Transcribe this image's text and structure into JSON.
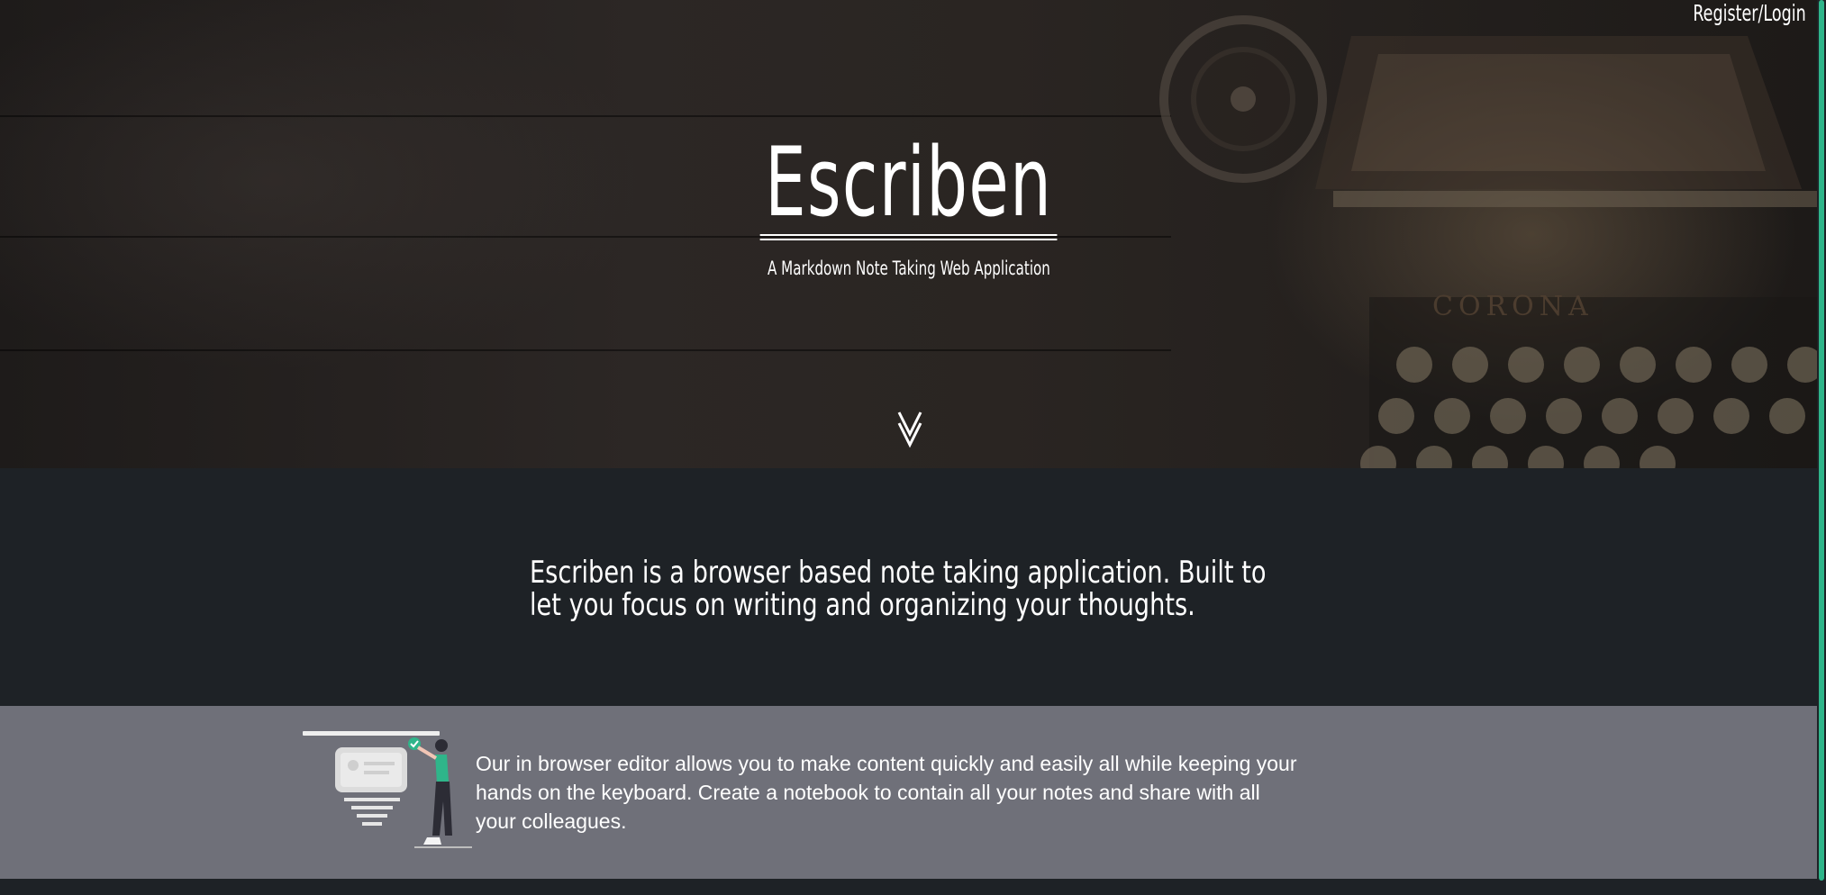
{
  "header": {
    "register_login_label": "Register/Login"
  },
  "hero": {
    "title": "Escriben",
    "subtitle": "A Markdown Note Taking Web Application",
    "scroll_icon": "chevron-down-icon"
  },
  "intro": {
    "text": "Escriben is a browser based note taking application. Built to let you focus on writing and organizing your thoughts."
  },
  "feature": {
    "illustration": "editor-illustration",
    "text": "Our in browser editor allows you to make content quickly and easily all while keeping your hands on the keyboard. Create a notebook to contain all your notes and share with all your colleagues."
  },
  "colors": {
    "accent": "#2fb58a",
    "dark_background": "#1e2226",
    "feature_background": "#6f7079",
    "text": "#ffffff"
  }
}
